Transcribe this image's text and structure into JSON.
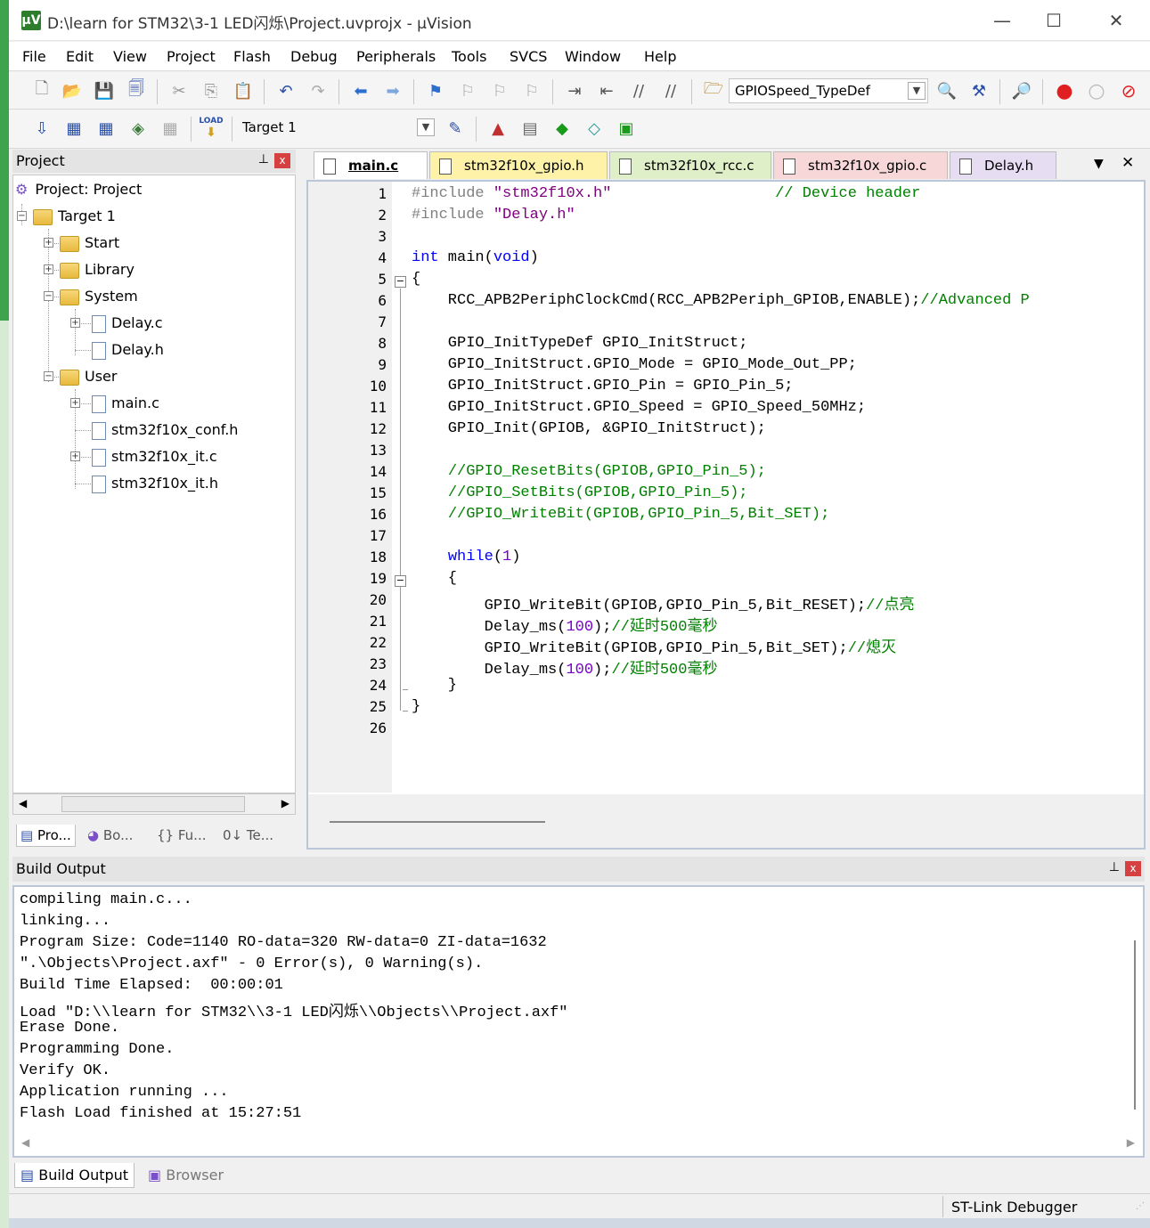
{
  "window": {
    "title": "D:\\learn for STM32\\3-1 LED闪烁\\Project.uvprojx - µVision",
    "app_icon": "µV",
    "minimize": "—",
    "maximize": "☐",
    "close": "✕"
  },
  "menu": [
    "File",
    "Edit",
    "View",
    "Project",
    "Flash",
    "Debug",
    "Peripherals",
    "Tools",
    "SVCS",
    "Window",
    "Help"
  ],
  "toolbar": {
    "find_combo": "GPIOSpeed_TypeDef",
    "target_combo": "Target 1",
    "load_label": "LOAD"
  },
  "project_panel": {
    "title": "Project",
    "pin": "⊥",
    "close": "x",
    "root": "Project: Project",
    "target": "Target 1",
    "groups": [
      {
        "name": "Start"
      },
      {
        "name": "Library"
      },
      {
        "name": "System",
        "files": [
          "Delay.c",
          "Delay.h"
        ]
      },
      {
        "name": "User",
        "files": [
          "main.c",
          "stm32f10x_conf.h",
          "stm32f10x_it.c",
          "stm32f10x_it.h"
        ]
      }
    ],
    "bottom_tabs": [
      "Pro...",
      "Bo...",
      "{} Fu...",
      "0↓ Te..."
    ]
  },
  "editor": {
    "tabs": [
      "main.c",
      "stm32f10x_gpio.h",
      "stm32f10x_rcc.c",
      "stm32f10x_gpio.c",
      "Delay.h"
    ],
    "tab_menu": "▼",
    "tab_close": "✕",
    "line_numbers": [
      "1",
      "2",
      "3",
      "4",
      "5",
      "6",
      "7",
      "8",
      "9",
      "10",
      "11",
      "12",
      "13",
      "14",
      "15",
      "16",
      "17",
      "18",
      "19",
      "20",
      "21",
      "22",
      "23",
      "24",
      "25",
      "26"
    ]
  },
  "build_output": {
    "title": "Build Output",
    "lines": [
      "compiling main.c...",
      "linking...",
      "Program Size: Code=1140 RO-data=320 RW-data=0 ZI-data=1632",
      "\".\\Objects\\Project.axf\" - 0 Error(s), 0 Warning(s).",
      "Build Time Elapsed:  00:00:01",
      "Load \"D:\\\\learn for STM32\\\\3-1 LED闪烁\\\\Objects\\\\Project.axf\"",
      "Erase Done.",
      "Programming Done.",
      "Verify OK.",
      "Application running ...",
      "Flash Load finished at 15:27:51"
    ],
    "tabs": [
      "Build Output",
      "Browser"
    ]
  },
  "status": {
    "debugger": "ST-Link Debugger"
  },
  "colors": {
    "keyword": "#0000ff",
    "comment": "#008000",
    "preprocessor": "#808080",
    "string": "#800080",
    "number": "#7a00d0",
    "close_red": "#d64040",
    "tab_yellow": "#fdf2a8",
    "tab_green": "#dff0c8",
    "tab_pink": "#f8d7d9",
    "tab_purple": "#e6ddf3"
  }
}
